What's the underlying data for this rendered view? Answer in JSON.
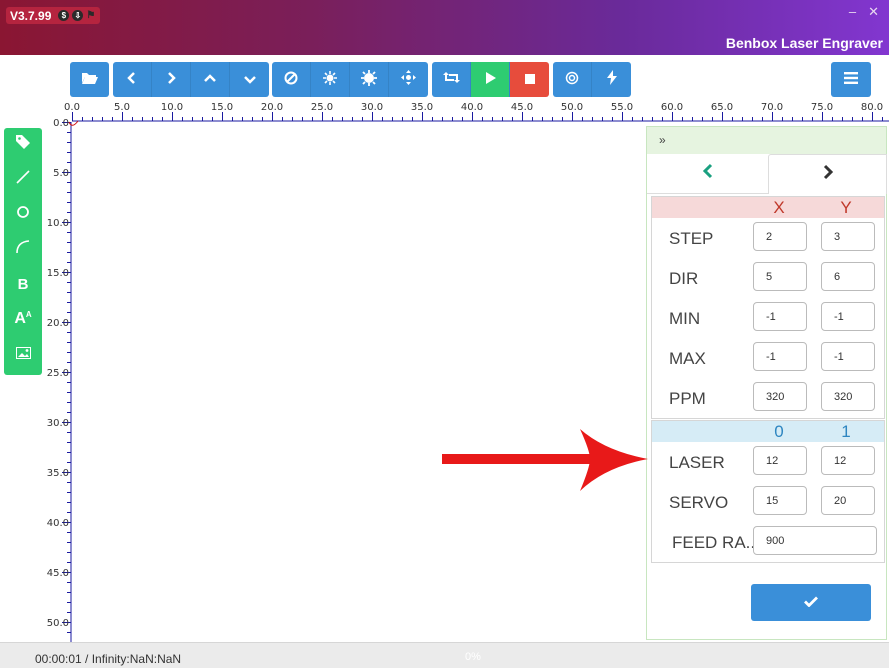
{
  "app": {
    "version": "V3.7.99",
    "title": "Benbox Laser Engraver",
    "window_minimize": "–",
    "window_close": "✕"
  },
  "toolbar": {
    "groups": [
      {
        "buttons": [
          {
            "icon": "folder-open-icon"
          }
        ]
      },
      {
        "buttons": [
          {
            "icon": "chevron-left-icon"
          },
          {
            "icon": "chevron-right-icon"
          },
          {
            "icon": "chevron-up-icon"
          },
          {
            "icon": "chevron-down-icon"
          }
        ]
      },
      {
        "buttons": [
          {
            "icon": "ban-icon"
          },
          {
            "icon": "burst-small-icon"
          },
          {
            "icon": "burst-large-icon"
          },
          {
            "icon": "move-crosshair-icon"
          }
        ]
      },
      {
        "buttons": [
          {
            "icon": "retweet-icon"
          },
          {
            "icon": "play-icon"
          },
          {
            "icon": "stop-icon"
          }
        ]
      },
      {
        "buttons": [
          {
            "icon": "target-icon"
          },
          {
            "icon": "lightning-icon"
          }
        ]
      }
    ],
    "menu_icon": "hamburger-menu-icon"
  },
  "ruler": {
    "horizontal_labels": [
      "0.0",
      "5.0",
      "10.0",
      "15.0",
      "20.0",
      "25.0",
      "30.0",
      "35.0",
      "40.0",
      "45.0",
      "50.0",
      "55.0",
      "60.0",
      "65.0",
      "70.0",
      "75.0",
      "80.0"
    ],
    "vertical_labels": [
      "0.0",
      "5.0",
      "10.0",
      "15.0",
      "20.0",
      "25.0",
      "30.0",
      "35.0",
      "40.0",
      "45.0",
      "50.0"
    ]
  },
  "palette": {
    "tools": [
      {
        "icon": "tag-icon"
      },
      {
        "icon": "line-icon"
      },
      {
        "icon": "circle-icon"
      },
      {
        "icon": "arc-icon"
      },
      {
        "icon": "bold-text-icon",
        "glyph": "B"
      },
      {
        "icon": "font-size-icon",
        "glyph": "A"
      },
      {
        "icon": "image-icon"
      }
    ]
  },
  "panel": {
    "collapse_glyph": "»",
    "axis_section": {
      "col1": "X",
      "col2": "Y",
      "rows": [
        {
          "label": "STEP",
          "x": "2",
          "y": "3"
        },
        {
          "label": "DIR",
          "x": "5",
          "y": "6"
        },
        {
          "label": "MIN",
          "x": "-1",
          "y": "-1"
        },
        {
          "label": "MAX",
          "x": "-1",
          "y": "-1"
        },
        {
          "label": "PPM",
          "x": "320",
          "y": "320"
        }
      ]
    },
    "output_section": {
      "col1": "0",
      "col2": "1",
      "rows": [
        {
          "label": "LASER",
          "v0": "12",
          "v1": "12"
        },
        {
          "label": "SERVO",
          "v0": "15",
          "v1": "20"
        }
      ],
      "feed_rate": {
        "label": "FEED RA..",
        "value": "900"
      }
    },
    "save_icon": "checkmark-icon"
  },
  "status": {
    "time": "00:00:01 / Infinity:NaN:NaN",
    "progress_text": "0%",
    "progress": 0
  },
  "colors": {
    "toolbar_blue": "#3a8fd9",
    "play_green": "#2ecc71",
    "stop_red": "#e74c3c",
    "palette_green": "#2ecc71",
    "ruler_blue": "#1a1aa0",
    "arrow_red": "#e81919"
  }
}
